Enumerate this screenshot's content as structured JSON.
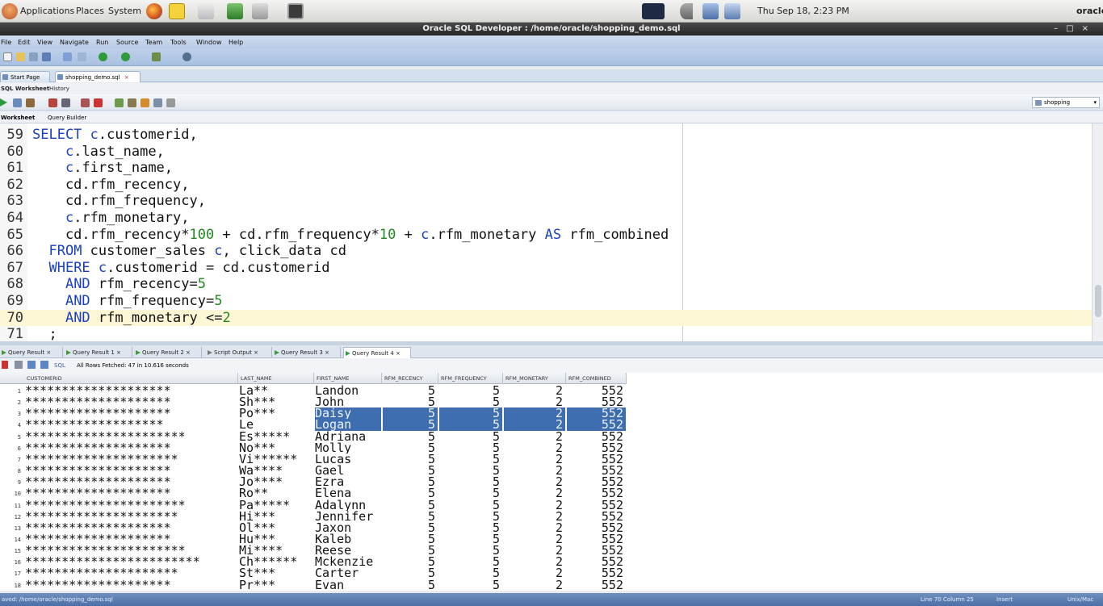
{
  "top_panel": {
    "applications": "Applications",
    "places": "Places",
    "system": "System",
    "clock": "Thu Sep 18,  2:23 PM",
    "user": "oracle"
  },
  "window": {
    "title": "Oracle SQL Developer : /home/oracle/shopping_demo.sql"
  },
  "menu": [
    "File",
    "Edit",
    "View",
    "Navigate",
    "Run",
    "Source",
    "Team",
    "Tools",
    "Window",
    "Help"
  ],
  "doc_tabs": [
    "Start Page",
    "shopping_demo.sql"
  ],
  "sub_tabs": [
    "SQL Worksheet",
    "History"
  ],
  "connection": "shopping",
  "worksheet_tabs": [
    "Worksheet",
    "Query Builder"
  ],
  "editor": {
    "lines": [
      {
        "n": "59",
        "code": "SELECT c.customerid,"
      },
      {
        "n": "60",
        "code": "    c.last_name,"
      },
      {
        "n": "61",
        "code": "    c.first_name,"
      },
      {
        "n": "62",
        "code": "    cd.rfm_recency,"
      },
      {
        "n": "63",
        "code": "    cd.rfm_frequency,"
      },
      {
        "n": "64",
        "code": "    c.rfm_monetary,"
      },
      {
        "n": "65",
        "code": "    cd.rfm_recency*100 + cd.rfm_frequency*10 + c.rfm_monetary AS rfm_combined"
      },
      {
        "n": "66",
        "code": "  FROM customer_sales c, click_data cd"
      },
      {
        "n": "67",
        "code": "  WHERE c.customerid = cd.customerid"
      },
      {
        "n": "68",
        "code": "    AND rfm_recency=5"
      },
      {
        "n": "69",
        "code": "    AND rfm_frequency=5"
      },
      {
        "n": "70",
        "code": "    AND rfm_monetary <=2"
      },
      {
        "n": "71",
        "code": "  ;"
      }
    ]
  },
  "result_tabs": [
    "Query Result",
    "Query Result 1",
    "Query Result 2",
    "Script Output",
    "Query Result 3",
    "Query Result 4"
  ],
  "result_status": "All Rows Fetched: 47 in 10.616 seconds",
  "result_sql_label": "SQL",
  "grid": {
    "columns": [
      "CUSTOMERID",
      "LAST_NAME",
      "FIRST_NAME",
      "RFM_RECENCY",
      "RFM_FREQUENCY",
      "RFM_MONETARY",
      "RFM_COMBINED"
    ],
    "rows": [
      [
        "1",
        "********************",
        "La**",
        "Landon",
        "5",
        "5",
        "2",
        "552"
      ],
      [
        "2",
        "********************",
        "Sh***",
        "John",
        "5",
        "5",
        "2",
        "552"
      ],
      [
        "3",
        "********************",
        "Po***",
        "Daisy",
        "5",
        "5",
        "2",
        "552"
      ],
      [
        "4",
        "*******************",
        "Le",
        "Logan",
        "5",
        "5",
        "2",
        "552"
      ],
      [
        "5",
        "**********************",
        "Es*****",
        "Adriana",
        "5",
        "5",
        "2",
        "552"
      ],
      [
        "6",
        "********************",
        "No***",
        "Molly",
        "5",
        "5",
        "2",
        "552"
      ],
      [
        "7",
        "*********************",
        "Vi******",
        "Lucas",
        "5",
        "5",
        "2",
        "552"
      ],
      [
        "8",
        "********************",
        "Wa****",
        "Gael",
        "5",
        "5",
        "2",
        "552"
      ],
      [
        "9",
        "********************",
        "Jo****",
        "Ezra",
        "5",
        "5",
        "2",
        "552"
      ],
      [
        "10",
        "********************",
        "Ro**",
        "Elena",
        "5",
        "5",
        "2",
        "552"
      ],
      [
        "11",
        "**********************",
        "Pa*****",
        "Adalynn",
        "5",
        "5",
        "2",
        "552"
      ],
      [
        "12",
        "*********************",
        "Hi***",
        "Jennifer",
        "5",
        "5",
        "2",
        "552"
      ],
      [
        "13",
        "********************",
        "Ol***",
        "Jaxon",
        "5",
        "5",
        "2",
        "552"
      ],
      [
        "14",
        "********************",
        "Hu***",
        "Kaleb",
        "5",
        "5",
        "2",
        "552"
      ],
      [
        "15",
        "**********************",
        "Mi****",
        "Reese",
        "5",
        "5",
        "2",
        "552"
      ],
      [
        "16",
        "************************",
        "Ch******",
        "Mckenzie",
        "5",
        "5",
        "2",
        "552"
      ],
      [
        "17",
        "*********************",
        "St***",
        "Carter",
        "5",
        "5",
        "2",
        "552"
      ],
      [
        "18",
        "********************",
        "Pr***",
        "Evan",
        "5",
        "5",
        "2",
        "552"
      ]
    ]
  },
  "status_bar": {
    "left": "aved: /home/oracle/shopping_demo.sql",
    "position": "Line 70 Column 25",
    "mode": "Insert",
    "eol": "Unix/Mac"
  },
  "colors": {
    "selection": "#3e6eb0",
    "current_line": "#fdf7d6",
    "keyword": "#1a3fbf",
    "number": "#1f8a1f"
  }
}
